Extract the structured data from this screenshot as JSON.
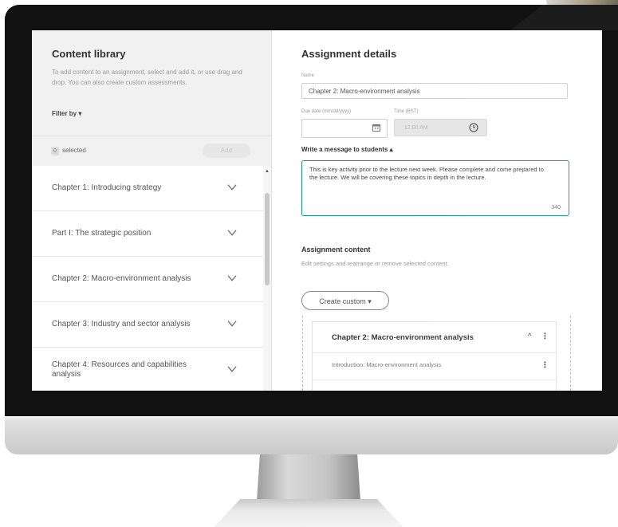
{
  "content_library": {
    "title": "Content library",
    "description": "To add content to an assignment, select and add it, or use drag and drop. You can also create custom assessments.",
    "filter_label": "Filter by",
    "selected_count": "0",
    "selected_label": "selected",
    "add_button": "Add",
    "items": [
      {
        "label": "Chapter 1: Introducing strategy"
      },
      {
        "label": "Part I: The strategic position"
      },
      {
        "label": "Chapter 2: Macro-environment analysis"
      },
      {
        "label": "Chapter 3: Industry and sector analysis"
      },
      {
        "label": "Chapter 4: Resources and capabilities analysis"
      }
    ]
  },
  "assignment_details": {
    "title": "Assignment details",
    "name_label": "Name",
    "name_value": "Chapter 2: Macro-environment analysis",
    "due_date_label": "Due date (mm/dd/yyyy)",
    "time_label": "Time (BST)",
    "time_placeholder": "12:00 AM",
    "message_label": "Write a message to students",
    "message_text": "This is key activity prior to the lecture next week. Please complete and come prepared to the lecture. We will be covering these topics in depth in the lecture.",
    "message_char_count": "340"
  },
  "assignment_content": {
    "title": "Assignment content",
    "description": "Edit settings and rearrange or remove selected content.",
    "create_custom_button": "Create custom",
    "card": {
      "title": "Chapter 2: Macro-environment analysis",
      "rows": [
        {
          "label": "Introduction: Macro-environment analysis"
        }
      ]
    }
  },
  "icons": {
    "filter_caret": "caret-down-icon",
    "chevron": "chevron-down-icon",
    "calendar": "calendar-icon",
    "clock": "clock-icon",
    "kebab": "kebab-menu-icon"
  },
  "colors": {
    "accent": "#1f8fa6",
    "left_panel_bg": "#f1f1f1"
  }
}
